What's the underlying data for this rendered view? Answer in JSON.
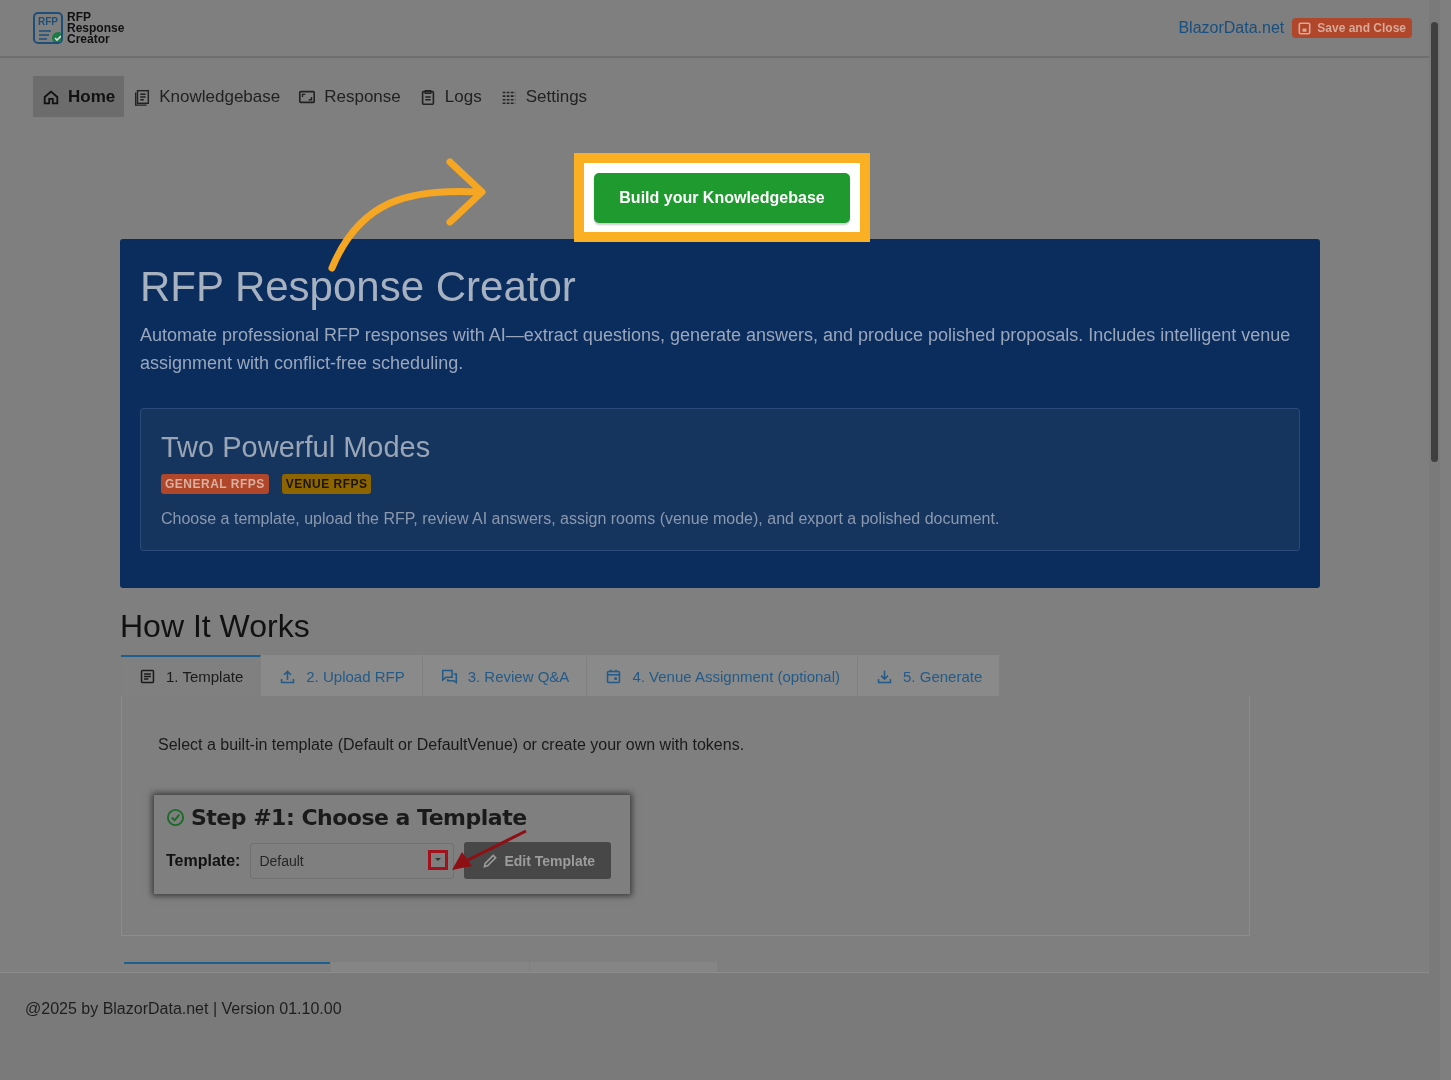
{
  "header": {
    "logo_badge": "RFP",
    "logo_lines": [
      "RFP",
      "Response",
      "Creator"
    ],
    "link": "BlazorData.net",
    "save_button": "Save and Close"
  },
  "nav": [
    {
      "label": "Home",
      "selected": true
    },
    {
      "label": "Knowledgebase",
      "selected": false
    },
    {
      "label": "Response",
      "selected": false
    },
    {
      "label": "Logs",
      "selected": false
    },
    {
      "label": "Settings",
      "selected": false
    }
  ],
  "cta_button": "Build your Knowledgebase",
  "hero": {
    "title": "RFP Response Creator",
    "description": "Automate professional RFP responses with AI—extract questions, generate answers, and produce polished proposals. Includes intelligent venue assignment with conflict-free scheduling.",
    "modes": {
      "title": "Two Powerful Modes",
      "badges": [
        {
          "label": "GENERAL RFPS",
          "color": "#b0472b"
        },
        {
          "label": "VENUE RFPS",
          "color": "#8c6500"
        }
      ],
      "text": "Choose a template, upload the RFP, review AI answers, assign rooms (venue mode), and export a polished document."
    }
  },
  "how_it_works": {
    "title": "How It Works",
    "tabs": [
      {
        "label": "1. Template",
        "selected": true
      },
      {
        "label": "2. Upload RFP",
        "selected": false
      },
      {
        "label": "3. Review Q&A",
        "selected": false
      },
      {
        "label": "4. Venue Assignment (optional)",
        "selected": false
      },
      {
        "label": "5. Generate",
        "selected": false
      }
    ],
    "panel_text": "Select a built-in template (Default or DefaultVenue) or create your own with tokens.",
    "step_card": {
      "title": "Step #1: Choose a Template",
      "field_label": "Template:",
      "value": "Default",
      "edit_button": "Edit Template"
    }
  },
  "lower_tabs": [
    {
      "selected": true
    },
    {
      "selected": false
    },
    {
      "selected": false
    }
  ],
  "footer": {
    "text": "@2025 by BlazorData.net | Version 01.10.00"
  }
}
